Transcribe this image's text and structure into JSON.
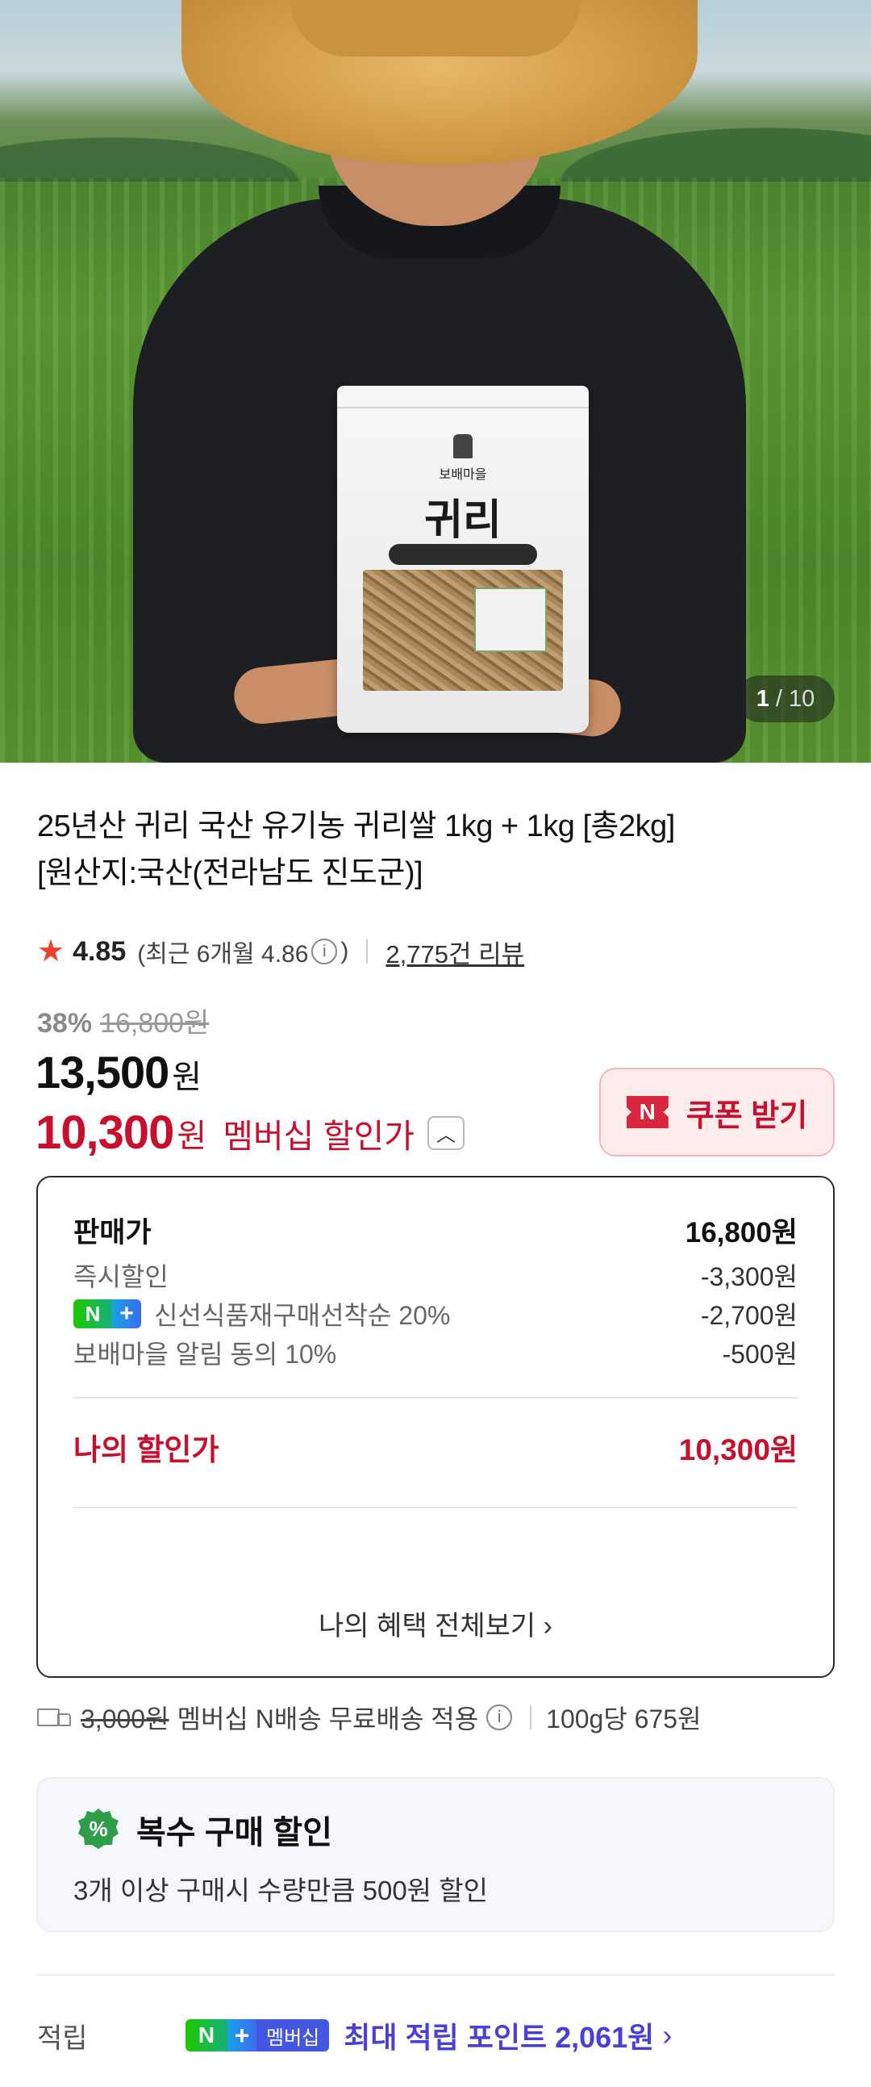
{
  "hero": {
    "bag_brand": "보배마을",
    "bag_name": "귀리",
    "pager_current": "1",
    "pager_total": "10"
  },
  "product": {
    "title_line1": "25년산 귀리 국산 유기농 귀리쌀 1kg + 1kg [총2kg]",
    "title_line2": "[원산지:국산(전라남도 진도군)]",
    "rating": "4.85",
    "recent_rating": "(최근 6개월 4.86",
    "recent_close": ")",
    "review_count": "2,775건 리뷰"
  },
  "pricing": {
    "discount_pct": "38%",
    "original_price": "16,800원",
    "sale_price": "13,500",
    "won": "원",
    "member_price": "10,300",
    "member_label": "멤버십 할인가",
    "coupon_label": "쿠폰 받기",
    "coupon_badge": "N"
  },
  "breakdown": {
    "rows": [
      {
        "label": "판매가",
        "value": "16,800원"
      },
      {
        "label": "즉시할인",
        "value": "-3,300원"
      },
      {
        "label": "신선식품재구매선착순 20%",
        "value": "-2,700원"
      },
      {
        "label": "보배마을 알림 동의 10%",
        "value": "-500원"
      }
    ],
    "my_price_label": "나의 할인가",
    "my_price_value": "10,300원",
    "see_all": "나의 혜택 전체보기",
    "see_all_chevron": "›"
  },
  "shipping": {
    "original_fee": "3,000원",
    "label": "멤버십 N배송 무료배송 적용",
    "unit_price": "100g당 675원"
  },
  "bulk": {
    "title": "복수 구매 할인",
    "description": "3개 이상 구매시 수량만큼 500원 할인",
    "icon_text": "%"
  },
  "points": {
    "label": "적립",
    "membership_badge": "멤버십",
    "max_points": "최대 적립 포인트 2,061원",
    "chevron": "›"
  },
  "colors": {
    "accent_red": "#c8102e",
    "naver_green": "#1ec800",
    "points_purple": "#4a3fd6"
  }
}
